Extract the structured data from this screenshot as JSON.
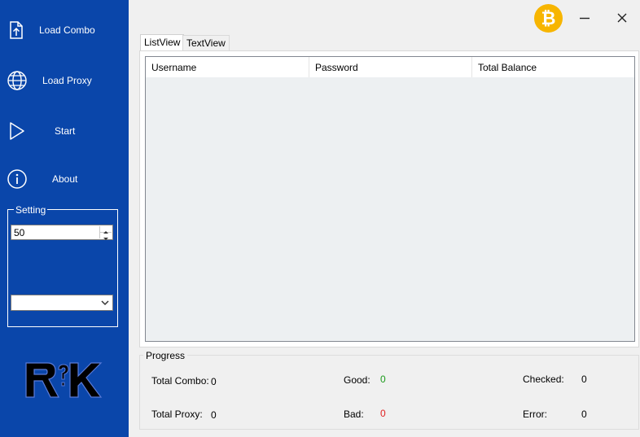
{
  "sidebar": {
    "items": [
      {
        "label": "Load Combo",
        "icon": "upload-file-icon"
      },
      {
        "label": "Load Proxy",
        "icon": "globe-icon"
      },
      {
        "label": "Start",
        "icon": "play-icon"
      },
      {
        "label": "About",
        "icon": "info-icon"
      }
    ],
    "setting": {
      "legend": "Setting",
      "threads_value": "50",
      "dropdown_value": ""
    }
  },
  "window": {
    "bitcoin_icon": "bitcoin-icon",
    "minimize_icon": "minimize-icon",
    "close_icon": "close-icon"
  },
  "tabs": [
    {
      "label": "ListView",
      "active": true
    },
    {
      "label": "TextView",
      "active": false
    }
  ],
  "list": {
    "columns": [
      "Username",
      "Password",
      "Total Balance"
    ]
  },
  "progress": {
    "legend": "Progress",
    "total_combo_label": "Total Combo:",
    "total_combo_value": "0",
    "total_proxy_label": "Total Proxy:",
    "total_proxy_value": "0",
    "good_label": "Good:",
    "good_value": "0",
    "bad_label": "Bad:",
    "bad_value": "0",
    "checked_label": "Checked:",
    "checked_value": "0",
    "error_label": "Error:",
    "error_value": "0"
  },
  "colors": {
    "sidebar": "#0a46aa",
    "good": "#1a9a1a",
    "bad": "#e02020",
    "bitcoin": "#f7b500"
  }
}
